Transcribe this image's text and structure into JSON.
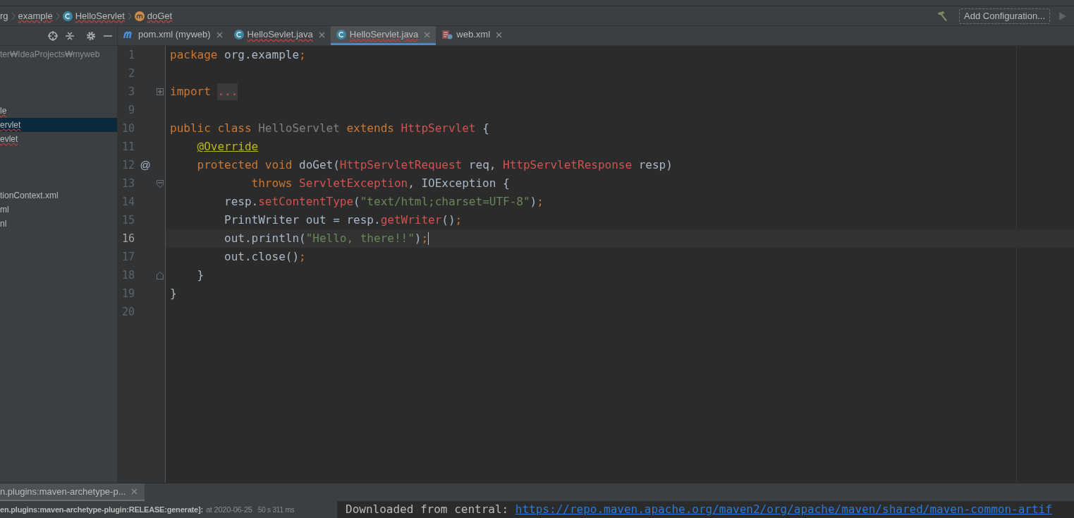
{
  "breadcrumbs": [
    {
      "label": "rg",
      "kind": "package",
      "typo": false
    },
    {
      "label": "example",
      "kind": "package",
      "typo": true
    },
    {
      "label": "HelloServlet",
      "kind": "class",
      "typo": true
    },
    {
      "label": "doGet",
      "kind": "method",
      "typo": true
    }
  ],
  "toolbar": {
    "configuration_button": "Add Configuration..."
  },
  "project_panel": {
    "path": "ter₩IdeaProjects₩myweb",
    "items": [
      {
        "label": "le",
        "selected": false,
        "typo": true
      },
      {
        "label": "ervlet",
        "selected": true,
        "typo": true
      },
      {
        "label": "evlet",
        "selected": false,
        "typo": true
      },
      {
        "label": "tionContext.xml",
        "selected": false,
        "typo": false
      },
      {
        "label": "ml",
        "selected": false,
        "typo": false
      },
      {
        "label": "nl",
        "selected": false,
        "typo": false
      }
    ]
  },
  "tabs": [
    {
      "label": "pom.xml (myweb)",
      "kind": "maven",
      "selected": false,
      "typo": false
    },
    {
      "label": "HelloSevlet.java",
      "kind": "class",
      "selected": false,
      "typo": true
    },
    {
      "label": "HelloServlet.java",
      "kind": "class",
      "selected": true,
      "typo": true
    },
    {
      "label": "web.xml",
      "kind": "xml",
      "selected": false,
      "typo": false
    }
  ],
  "editor": {
    "lines": [
      {
        "number": "1",
        "current": false,
        "collapsed": false,
        "fold_start": false,
        "fold_end": false,
        "segments": [
          {
            "kind": "keyword",
            "text": "package "
          },
          {
            "kind": "plain",
            "text": "org.example"
          },
          {
            "kind": "keyword",
            "text": ";"
          }
        ]
      },
      {
        "number": "2",
        "current": false,
        "collapsed": false,
        "fold_start": false,
        "fold_end": false
      },
      {
        "number": "3",
        "current": false,
        "collapsed": true,
        "fold_start": false,
        "fold_end": false,
        "segments": [
          {
            "kind": "keyword",
            "text": "import "
          },
          {
            "kind": "folded",
            "text": "..."
          }
        ]
      },
      {
        "number": "9",
        "current": false,
        "collapsed": false,
        "fold_start": false,
        "fold_end": false
      },
      {
        "number": "10",
        "current": false,
        "collapsed": false,
        "fold_start": false,
        "fold_end": false,
        "segments": [
          {
            "kind": "keyword",
            "text": "public class "
          },
          {
            "kind": "unused",
            "text": "HelloServlet "
          },
          {
            "kind": "keyword",
            "text": "extends "
          },
          {
            "kind": "error",
            "text": "HttpServlet"
          },
          {
            "kind": "plain",
            "text": " {"
          }
        ]
      },
      {
        "number": "11",
        "current": false,
        "collapsed": false,
        "fold_start": false,
        "fold_end": false,
        "segments": [
          {
            "kind": "annotation",
            "text": "    @Override"
          }
        ]
      },
      {
        "number": "12",
        "current": false,
        "collapsed": false,
        "fold_start": false,
        "fold_end": false,
        "gutter_mark": "@",
        "segments": [
          {
            "kind": "keyword",
            "text": "    protected void "
          },
          {
            "kind": "plain",
            "text": "doGet("
          },
          {
            "kind": "error",
            "text": "HttpServletRequest"
          },
          {
            "kind": "plain",
            "text": " req, "
          },
          {
            "kind": "error",
            "text": "HttpServletResponse"
          },
          {
            "kind": "plain",
            "text": " resp)"
          }
        ]
      },
      {
        "number": "13",
        "current": false,
        "collapsed": false,
        "fold_start": true,
        "fold_end": false,
        "segments": [
          {
            "kind": "keyword",
            "text": "            throws "
          },
          {
            "kind": "error",
            "text": "ServletException"
          },
          {
            "kind": "plain",
            "text": ", IOException {"
          }
        ]
      },
      {
        "number": "14",
        "current": false,
        "collapsed": false,
        "fold_start": false,
        "fold_end": false,
        "segments": [
          {
            "kind": "plain",
            "text": "        resp."
          },
          {
            "kind": "error",
            "text": "setContentType"
          },
          {
            "kind": "plain",
            "text": "("
          },
          {
            "kind": "string",
            "text": "\"text/html;charset=UTF-8\""
          },
          {
            "kind": "plain",
            "text": ")"
          },
          {
            "kind": "keyword",
            "text": ";"
          }
        ]
      },
      {
        "number": "15",
        "current": false,
        "collapsed": false,
        "fold_start": false,
        "fold_end": false,
        "segments": [
          {
            "kind": "plain",
            "text": "        PrintWriter out = resp."
          },
          {
            "kind": "error",
            "text": "getWriter"
          },
          {
            "kind": "plain",
            "text": "()"
          },
          {
            "kind": "keyword",
            "text": ";"
          }
        ]
      },
      {
        "number": "16",
        "current": true,
        "collapsed": false,
        "fold_start": false,
        "fold_end": false,
        "segments": [
          {
            "kind": "plain",
            "text": "        out.println("
          },
          {
            "kind": "string",
            "text": "\"Hello, there!!\""
          },
          {
            "kind": "plain",
            "text": ")"
          },
          {
            "kind": "keyword",
            "text": ";"
          }
        ]
      },
      {
        "number": "17",
        "current": false,
        "collapsed": false,
        "fold_start": false,
        "fold_end": false,
        "segments": [
          {
            "kind": "plain",
            "text": "        out.close()"
          },
          {
            "kind": "keyword",
            "text": ";"
          }
        ]
      },
      {
        "number": "18",
        "current": false,
        "collapsed": false,
        "fold_start": false,
        "fold_end": true,
        "segments": [
          {
            "kind": "plain",
            "text": "    }"
          }
        ]
      },
      {
        "number": "19",
        "current": false,
        "collapsed": false,
        "fold_start": false,
        "fold_end": false,
        "segments": [
          {
            "kind": "plain",
            "text": "}"
          }
        ]
      },
      {
        "number": "20",
        "current": false,
        "collapsed": false,
        "fold_start": false,
        "fold_end": false
      }
    ]
  },
  "run_panel": {
    "tab": "n.plugins:maven-archetype-p...",
    "task": "en.plugins:maven-archetype-plugin:RELEASE:generate]:",
    "when": "at 2020-06-25",
    "duration": "50 s 311 ms",
    "console_text": "Downloaded from central: ",
    "console_link": "https://repo.maven.apache.org/maven2/org/apache/maven/shared/maven-common-artif"
  }
}
